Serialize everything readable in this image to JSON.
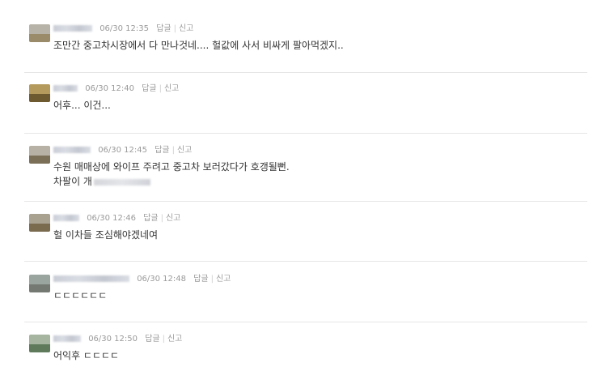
{
  "reply_label": "답글",
  "report_label": "신고",
  "comments": [
    {
      "time": "06/30 12:35",
      "text": "조만간 중고차시장에서 다 만나것네.... 헐값에 사서 비싸게 팔아먹겠지.."
    },
    {
      "time": "06/30 12:40",
      "text": "어후... 이건..."
    },
    {
      "time": "06/30 12:45",
      "text": "수원 매매상에 와이프 주려고 중고차 보러갔다가 호갱될뻔.",
      "text2": "차팔이 개"
    },
    {
      "time": "06/30 12:46",
      "text": "헐 이차들 조심해야겠네여"
    },
    {
      "time": "06/30 12:48",
      "text": "ㄷㄷㄷㄷㄷㄷ"
    },
    {
      "time": "06/30 12:50",
      "text": "어익후 ㄷㄷㄷㄷ"
    }
  ]
}
